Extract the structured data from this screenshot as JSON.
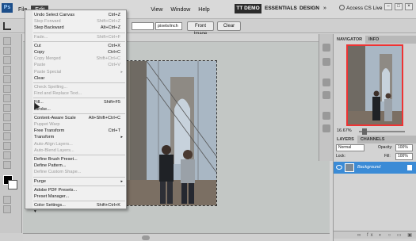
{
  "app": {
    "logo_text": "Ps"
  },
  "menubar": {
    "items": [
      "File",
      "Edit"
    ],
    "items_after": [
      "View",
      "Window",
      "Help"
    ],
    "active": "Edit"
  },
  "workspace": {
    "demo_label": "TT DEMO",
    "essentials": "ESSENTIALS",
    "design": "DESIGN",
    "more": "»",
    "cs_live": "Access CS Live"
  },
  "options_bar": {
    "resolution_unit": "pixels/inch",
    "front_image": "Front Image",
    "clear": "Clear"
  },
  "edit_menu": [
    {
      "label": "Undo Select Canvas",
      "shortcut": "Ctrl+Z",
      "disabled": false
    },
    {
      "label": "Step Forward",
      "shortcut": "Shift+Ctrl+Z",
      "disabled": true
    },
    {
      "label": "Step Backward",
      "shortcut": "Alt+Ctrl+Z",
      "disabled": false
    },
    {
      "sep": true
    },
    {
      "label": "Fade...",
      "shortcut": "Shift+Ctrl+F",
      "disabled": true
    },
    {
      "sep": true
    },
    {
      "label": "Cut",
      "shortcut": "Ctrl+X",
      "disabled": false
    },
    {
      "label": "Copy",
      "shortcut": "Ctrl+C",
      "disabled": false
    },
    {
      "label": "Copy Merged",
      "shortcut": "Shift+Ctrl+C",
      "disabled": true
    },
    {
      "label": "Paste",
      "shortcut": "Ctrl+V",
      "disabled": true
    },
    {
      "label": "Paste Special",
      "shortcut": "",
      "disabled": true,
      "submenu": true
    },
    {
      "label": "Clear",
      "shortcut": "",
      "disabled": false
    },
    {
      "sep": true
    },
    {
      "label": "Check Spelling...",
      "shortcut": "",
      "disabled": true
    },
    {
      "label": "Find and Replace Text...",
      "shortcut": "",
      "disabled": true
    },
    {
      "sep": true
    },
    {
      "label": "Fill...",
      "shortcut": "Shift+F5",
      "disabled": false
    },
    {
      "label": "Stroke...",
      "shortcut": "",
      "disabled": false
    },
    {
      "sep": true
    },
    {
      "label": "Content-Aware Scale",
      "shortcut": "Alt+Shift+Ctrl+C",
      "disabled": false
    },
    {
      "label": "Puppet Warp",
      "shortcut": "",
      "disabled": true
    },
    {
      "label": "Free Transform",
      "shortcut": "Ctrl+T",
      "disabled": false
    },
    {
      "label": "Transform",
      "shortcut": "",
      "disabled": false,
      "submenu": true
    },
    {
      "label": "Auto-Align Layers...",
      "shortcut": "",
      "disabled": true
    },
    {
      "label": "Auto-Blend Layers...",
      "shortcut": "",
      "disabled": true
    },
    {
      "sep": true
    },
    {
      "label": "Define Brush Preset...",
      "shortcut": "",
      "disabled": false
    },
    {
      "label": "Define Pattern...",
      "shortcut": "",
      "disabled": false
    },
    {
      "label": "Define Custom Shape...",
      "shortcut": "",
      "disabled": true
    },
    {
      "sep": true
    },
    {
      "label": "Purge",
      "shortcut": "",
      "disabled": false,
      "submenu": true
    },
    {
      "sep": true
    },
    {
      "label": "Adobe PDF Presets...",
      "shortcut": "",
      "disabled": false
    },
    {
      "label": "Preset Manager...",
      "shortcut": "",
      "disabled": false
    },
    {
      "sep": true
    },
    {
      "label": "Color Settings...",
      "shortcut": "Shift+Ctrl+K",
      "disabled": false
    },
    {
      "label": "▾",
      "shortcut": "",
      "disabled": false
    }
  ],
  "navigator": {
    "tabs": [
      "NAVIGATOR",
      "INFO"
    ],
    "zoom": "16.67%"
  },
  "layers": {
    "tabs": [
      "LAYERS",
      "CHANNELS"
    ],
    "blend_mode": "Normal",
    "opacity_label": "Opacity:",
    "opacity": "100%",
    "lock_label": "Lock:",
    "fill_label": "Fill:",
    "fill": "100%",
    "layer_name": "Background"
  },
  "colors": {
    "menu_active": "#3f3f3f",
    "layer_selected": "#3b8bd6",
    "nav_frame": "#e33333"
  }
}
